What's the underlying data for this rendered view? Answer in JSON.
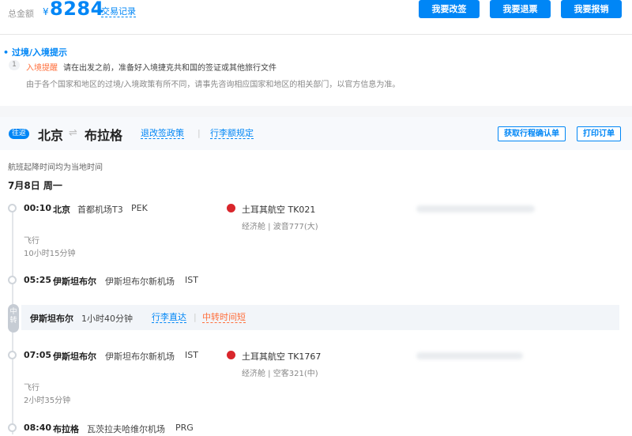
{
  "header": {
    "total_label": "总金额",
    "currency": "¥",
    "amount": "8284",
    "records_link": "交易记录",
    "buttons": [
      "我要改签",
      "我要退票",
      "我要报销"
    ]
  },
  "notice": {
    "title": "过境/入境提示",
    "items": [
      {
        "index": "1",
        "tag": "入境提醒",
        "text": "请在出发之前，准备好入境捷克共和国的签证或其他旅行文件",
        "sub": "由于各个国家和地区的过境/入境政策有所不同，请事先咨询相应国家和地区的相关部门，以官方信息为准。"
      }
    ]
  },
  "route": {
    "badge": "往返",
    "from": "北京",
    "arrow": "⇌",
    "to": "布拉格",
    "policy_link": "退改签政策",
    "separator": "|",
    "luggage_link": "行李额规定",
    "confirm_button": "获取行程确认单",
    "print_button": "打印订单"
  },
  "local_time_note": "航班起降时间均为当地时间",
  "date": "7月8日 周一",
  "segments": [
    {
      "dep_time": "00:10",
      "dep_city": "北京",
      "dep_airport": "首都机场T3",
      "dep_code": "PEK",
      "airline": "土耳其航空 TK021",
      "cabin": "经济舱 | 波音777(大)",
      "fly_label": "飞行",
      "duration": "10小时15分钟",
      "arr_time": "05:25",
      "arr_city": "伊斯坦布尔",
      "arr_airport": "伊斯坦布尔新机场",
      "arr_code": "IST"
    },
    {
      "dep_time": "07:05",
      "dep_city": "伊斯坦布尔",
      "dep_airport": "伊斯坦布尔新机场",
      "dep_code": "IST",
      "airline": "土耳其航空 TK1767",
      "cabin": "经济舱 | 空客321(中)",
      "fly_label": "飞行",
      "duration": "2小时35分钟",
      "arr_time": "08:40",
      "arr_city": "布拉格",
      "arr_airport": "瓦茨拉夫哈维尔机场",
      "arr_code": "PRG"
    }
  ],
  "transfer": {
    "badge": "中转",
    "city": "伊斯坦布尔",
    "duration": "1小时40分钟",
    "luggage_direct": "行李直达",
    "separator": "|",
    "short_warning": "中转时间短"
  },
  "colors": {
    "accent": "#0086f6",
    "warning": "#ff6f3c",
    "airline_logo": "#d9262c"
  }
}
